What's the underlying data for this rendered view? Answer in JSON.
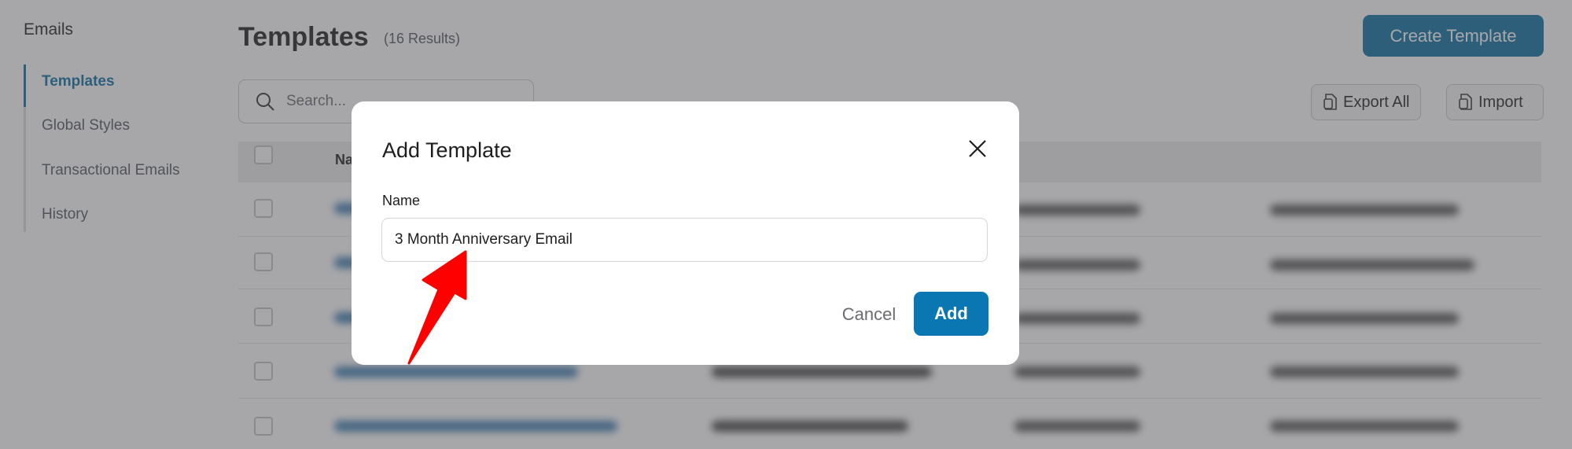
{
  "sidebar": {
    "title": "Emails",
    "items": [
      {
        "label": "Templates",
        "active": true
      },
      {
        "label": "Global Styles",
        "active": false
      },
      {
        "label": "Transactional Emails",
        "active": false
      },
      {
        "label": "History",
        "active": false
      }
    ]
  },
  "header": {
    "title": "Templates",
    "results": "(16 Results)",
    "create_label": "Create Template"
  },
  "toolbar": {
    "search_placeholder": "Search...",
    "export_label": "Export All",
    "import_label": "Import"
  },
  "table": {
    "columns": [
      "Name"
    ]
  },
  "modal": {
    "title": "Add Template",
    "name_label": "Name",
    "name_value": "3 Month Anniversary Email",
    "cancel_label": "Cancel",
    "add_label": "Add"
  },
  "colors": {
    "accent": "#0a6ea3",
    "add_button": "#0a77b3",
    "annotation_arrow": "#ff0000"
  },
  "icons": [
    "search-icon",
    "export-file-icon",
    "import-file-icon",
    "close-icon",
    "annotation-arrow-icon"
  ]
}
